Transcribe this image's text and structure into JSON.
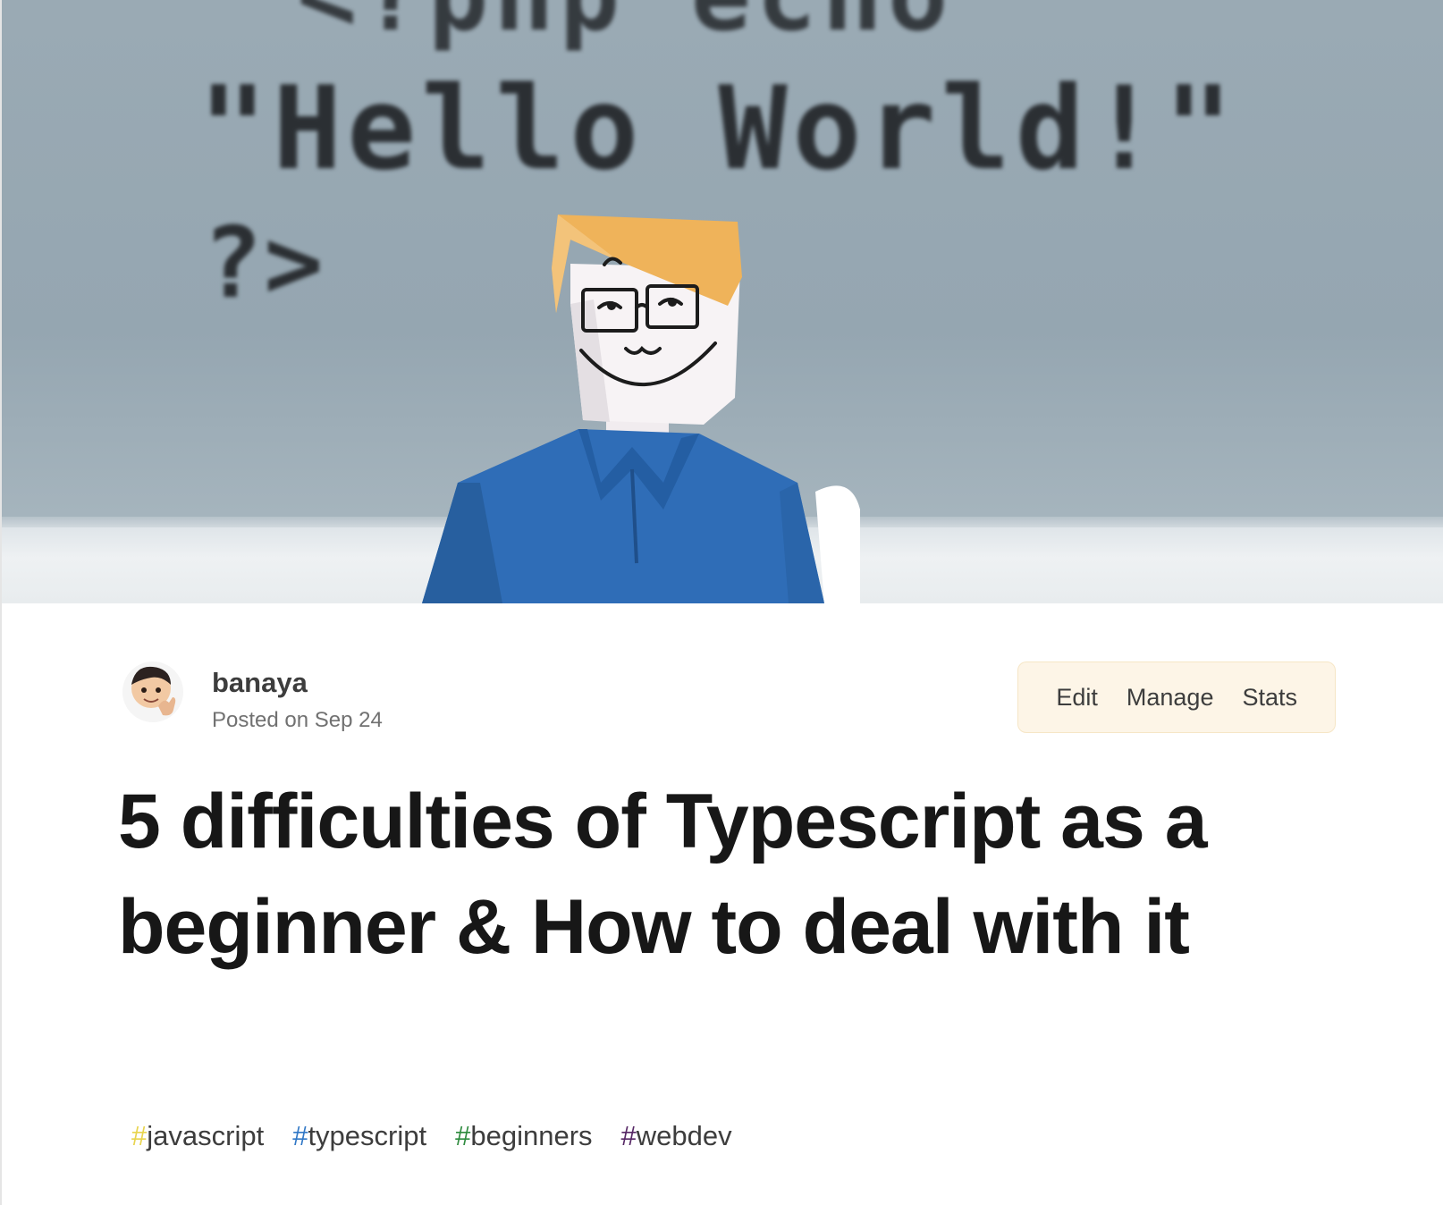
{
  "cover": {
    "code_lines": [
      "<?php echo",
      "\"Hello World!\"",
      "?>"
    ]
  },
  "author": {
    "name": "banaya",
    "posted": "Posted on Sep 24"
  },
  "actions": {
    "edit": "Edit",
    "manage": "Manage",
    "stats": "Stats"
  },
  "article": {
    "title": "5 difficulties of Typescript as a beginner & How to deal with it"
  },
  "tags": [
    {
      "hash": "#",
      "name": "javascript",
      "color": "#e8d44d"
    },
    {
      "hash": "#",
      "name": "typescript",
      "color": "#3178c6"
    },
    {
      "hash": "#",
      "name": "beginners",
      "color": "#2e8b3e"
    },
    {
      "hash": "#",
      "name": "webdev",
      "color": "#562765"
    }
  ],
  "colors": {
    "actions_bg": "#fdf5e7",
    "title": "#171717",
    "meta": "#717171"
  }
}
